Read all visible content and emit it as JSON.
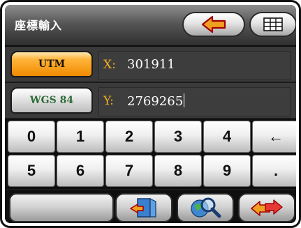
{
  "title": "座標輸入",
  "header": {
    "back_icon": "arrow-left-icon",
    "grid_icon": "grid-table-icon"
  },
  "coords": {
    "systems": [
      "UTM",
      "WGS 84"
    ],
    "x": {
      "label": "X:",
      "value": "301911"
    },
    "y": {
      "label": "Y:",
      "value": "2769265"
    }
  },
  "keypad": {
    "row1": [
      "0",
      "1",
      "2",
      "3",
      "4",
      "←"
    ],
    "row2": [
      "5",
      "6",
      "7",
      "8",
      "9",
      "."
    ]
  },
  "bottom": {
    "icons": [
      "map-export-icon",
      "magnifier-globe-icon",
      "arrow-route-icon"
    ]
  },
  "colors": {
    "accent_orange": "#f08a00",
    "axis_label": "#f0b020",
    "wgs_text": "#2e6b3a"
  }
}
